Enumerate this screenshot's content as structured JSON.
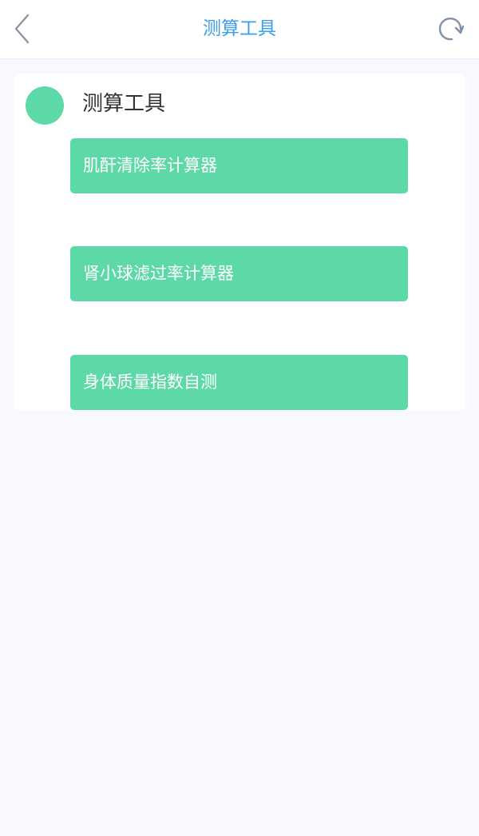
{
  "theme": {
    "accent": "#5dd9a8",
    "title_color": "#3a9ee8",
    "background": "#f7f9fe"
  },
  "header": {
    "title": "测算工具",
    "back_icon": "chevron-left-icon",
    "refresh_icon": "refresh-icon"
  },
  "section": {
    "title": "测算工具",
    "tools": [
      {
        "label": "肌酐清除率计算器"
      },
      {
        "label": "肾小球滤过率计算器"
      },
      {
        "label": "身体质量指数自测"
      }
    ]
  }
}
